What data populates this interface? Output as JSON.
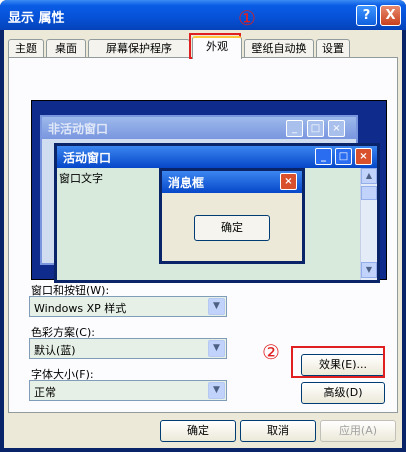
{
  "window": {
    "title": "显示 属性",
    "help_label": "?",
    "close_label": "X"
  },
  "tabs": [
    "主题",
    "桌面",
    "屏幕保护程序",
    "外观",
    "壁纸自动换",
    "设置"
  ],
  "annotations": {
    "one": "①",
    "two": "②"
  },
  "preview": {
    "inactive_title": "非活动窗口",
    "active_title": "活动窗口",
    "window_text": "窗口文字",
    "message_title": "消息框",
    "ok_label": "确定"
  },
  "fields": {
    "windows_buttons_label": "窗口和按钮(W):",
    "windows_buttons_value": "Windows XP 样式",
    "color_scheme_label": "色彩方案(C):",
    "color_scheme_value": "默认(蓝)",
    "font_size_label": "字体大小(F):",
    "font_size_value": "正常"
  },
  "buttons": {
    "effects": "效果(E)...",
    "advanced": "高级(D)",
    "ok": "确定",
    "cancel": "取消",
    "apply": "应用(A)"
  },
  "colors": {
    "titlebar": "#0651d6",
    "dialog_bg": "#ece9d8",
    "annotation": "#e02020"
  }
}
